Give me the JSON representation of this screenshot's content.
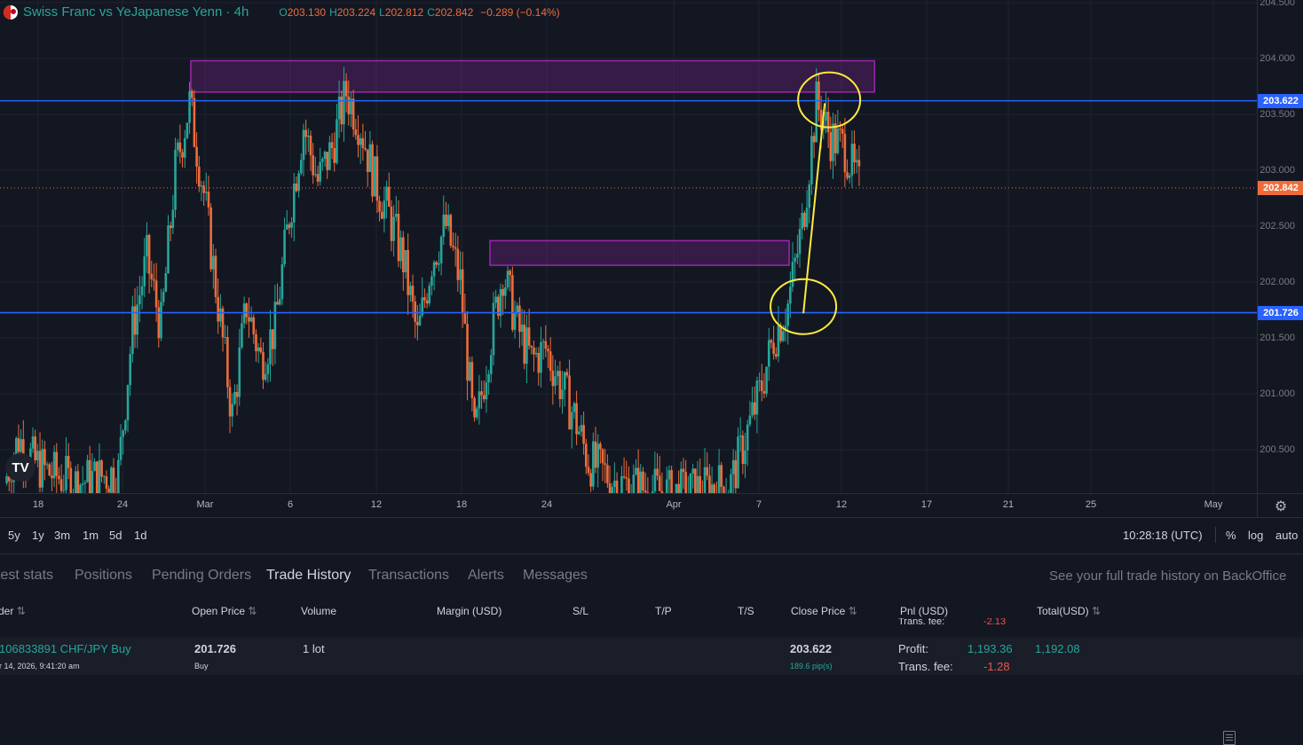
{
  "legend": {
    "title": "Swiss Franc vs YeJapanese Yenn · 4h",
    "o_key": "O",
    "o_val": "203.130",
    "h_key": "H",
    "h_val": "203.224",
    "l_key": "L",
    "l_val": "202.812",
    "c_key": "C",
    "c_val": "202.842",
    "change": "−0.289 (−0.14%)"
  },
  "logo": "TV",
  "price_axis": {
    "ticks": [
      "204.500",
      "204.000",
      "203.500",
      "203.000",
      "202.500",
      "202.000",
      "201.500",
      "201.000",
      "200.500"
    ],
    "label_top": "203.622",
    "label_current": "202.842",
    "label_bottom": "201.726"
  },
  "time_axis": {
    "ticks": [
      "18",
      "24",
      "Mar",
      "6",
      "12",
      "18",
      "24",
      "Apr",
      "7",
      "12",
      "17",
      "21",
      "25",
      "May"
    ]
  },
  "range_bar": {
    "ranges": [
      "5y",
      "1y",
      "3m",
      "1m",
      "5d",
      "1d"
    ],
    "clock": "10:28:18 (UTC)",
    "percent": "%",
    "log": "log",
    "auto": "auto"
  },
  "panel": {
    "tabs": [
      "test stats",
      "Positions",
      "Pending Orders",
      "Trade History",
      "Transactions",
      "Alerts",
      "Messages"
    ],
    "active_tab": "Trade History",
    "backoffice": "See your full trade history on BackOffice",
    "headers": {
      "order": "der",
      "open_price": "Open Price",
      "volume": "Volume",
      "margin": "Margin (USD)",
      "sl": "S/L",
      "tp": "T/P",
      "ts": "T/S",
      "close_price": "Close Price",
      "pnl": "Pnl (USD)",
      "total": "Total(USD)"
    },
    "partial_row": {
      "label": "Trans. fee:",
      "value": "-2.13"
    },
    "row": {
      "order_id": "106833891 CHF/JPY Buy",
      "date": "r 14, 2026, 9:41:20 am",
      "open_price": "201.726",
      "side": "Buy",
      "volume": "1 lot",
      "close_price": "203.622",
      "pips": "189.6 pip(s)",
      "profit_label": "Profit:",
      "profit_value": "1,193.36",
      "fee_label": "Trans. fee:",
      "fee_value": "-1.28",
      "total": "1,192.08"
    }
  },
  "colors": {
    "up": "#26a69a",
    "down": "#ef6c3a",
    "hline": "#2962ff",
    "zone": "#9c27b0",
    "annotation": "#ffeb3b"
  },
  "chart_data": {
    "type": "candlestick",
    "symbol": "CHF/JPY",
    "interval": "4h",
    "ylim": [
      500.2,
      204.5
    ],
    "y_range": [
      200.2,
      204.6
    ],
    "x_ticks": [
      "18",
      "24",
      "Mar",
      "6",
      "12",
      "18",
      "24",
      "Apr",
      "7",
      "12",
      "17",
      "21",
      "25",
      "May"
    ],
    "horizontal_lines": [
      203.622,
      201.726
    ],
    "last_price": 202.842,
    "zones": [
      {
        "from": "Feb 29",
        "to": "Apr 17",
        "low": 203.7,
        "high": 203.98
      },
      {
        "from": "Mar 21",
        "to": "Apr 11",
        "low": 202.15,
        "high": 202.37
      }
    ],
    "close_series": [
      {
        "d": "Feb 16",
        "c": 200.2
      },
      {
        "d": "Feb 17",
        "c": 200.6
      },
      {
        "d": "Feb 18",
        "c": 200.4
      },
      {
        "d": "Feb 19",
        "c": 200.3
      },
      {
        "d": "Feb 21",
        "c": 200.2
      },
      {
        "d": "Feb 24",
        "c": 200.3
      },
      {
        "d": "Feb 25",
        "c": 201.6
      },
      {
        "d": "Feb 26",
        "c": 202.2
      },
      {
        "d": "Feb 27",
        "c": 201.6
      },
      {
        "d": "Feb 28",
        "c": 203.0
      },
      {
        "d": "Feb 29",
        "c": 203.6
      },
      {
        "d": "Mar 1",
        "c": 202.8
      },
      {
        "d": "Mar 2",
        "c": 201.8
      },
      {
        "d": "Mar 3",
        "c": 200.8
      },
      {
        "d": "Mar 4",
        "c": 201.8
      },
      {
        "d": "Mar 5",
        "c": 201.3
      },
      {
        "d": "Mar 6",
        "c": 201.6
      },
      {
        "d": "Mar 7",
        "c": 202.6
      },
      {
        "d": "Mar 8",
        "c": 203.4
      },
      {
        "d": "Mar 9",
        "c": 202.9
      },
      {
        "d": "Mar 10",
        "c": 203.2
      },
      {
        "d": "Mar 11",
        "c": 203.7
      },
      {
        "d": "Mar 12",
        "c": 203.4
      },
      {
        "d": "Mar 13",
        "c": 202.9
      },
      {
        "d": "Mar 14",
        "c": 202.6
      },
      {
        "d": "Mar 15",
        "c": 202.2
      },
      {
        "d": "Mar 16",
        "c": 201.5
      },
      {
        "d": "Mar 17",
        "c": 202.2
      },
      {
        "d": "Mar 18",
        "c": 202.5
      },
      {
        "d": "Mar 19",
        "c": 202.0
      },
      {
        "d": "Mar 20",
        "c": 200.6
      },
      {
        "d": "Mar 21",
        "c": 201.4
      },
      {
        "d": "Mar 22",
        "c": 202.1
      },
      {
        "d": "Mar 23",
        "c": 201.6
      },
      {
        "d": "Mar 24",
        "c": 201.3
      },
      {
        "d": "Mar 25",
        "c": 201.4
      },
      {
        "d": "Mar 26",
        "c": 201.1
      },
      {
        "d": "Mar 27",
        "c": 200.8
      },
      {
        "d": "Mar 28",
        "c": 200.4
      },
      {
        "d": "Mar 30",
        "c": 200.2
      },
      {
        "d": "Apr 3",
        "c": 200.1
      },
      {
        "d": "Apr 7",
        "c": 200.2
      },
      {
        "d": "Apr 8",
        "c": 200.6
      },
      {
        "d": "Apr 9",
        "c": 201.0
      },
      {
        "d": "Apr 10",
        "c": 201.5
      },
      {
        "d": "Apr 11",
        "c": 201.8
      },
      {
        "d": "Apr 12",
        "c": 202.5
      },
      {
        "d": "Apr 13",
        "c": 203.6
      },
      {
        "d": "Apr 14",
        "c": 203.3
      },
      {
        "d": "Apr 15",
        "c": 203.2
      },
      {
        "d": "Apr 16",
        "c": 202.84
      }
    ]
  }
}
